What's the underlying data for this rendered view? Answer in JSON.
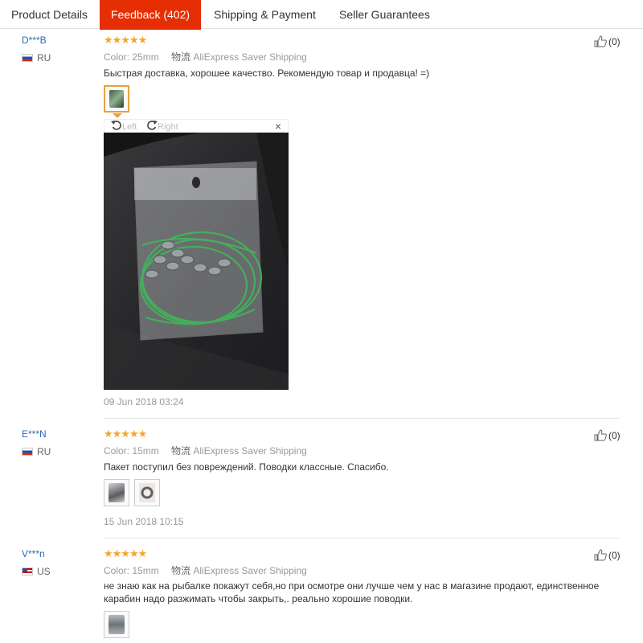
{
  "tabs": [
    {
      "label": "Product Details"
    },
    {
      "label": "Feedback (402)"
    },
    {
      "label": "Shipping & Payment"
    },
    {
      "label": "Seller Guarantees"
    }
  ],
  "colors": {
    "accent": "#e62e04",
    "star": "#f5a623",
    "link": "#2a6ab6"
  },
  "reviews": [
    {
      "user": "D***B",
      "country": "RU",
      "stars": "★★★★★",
      "color_label": "Color:",
      "color_value": "25mm",
      "ship_label": "物流",
      "ship_value": "AliExpress Saver Shipping",
      "text": "Быстрая доставка, хорошее качество. Рекомендую товар и продавца! =)",
      "date": "09 Jun 2018 03:24",
      "helpful": "(0)"
    },
    {
      "user": "E***N",
      "country": "RU",
      "stars": "★★★★★",
      "color_label": "Color:",
      "color_value": "15mm",
      "ship_label": "物流",
      "ship_value": "AliExpress Saver Shipping",
      "text": "Пакет поступил без повреждений. Поводки классные. Спасибо.",
      "date": "15 Jun 2018 10:15",
      "helpful": "(0)"
    },
    {
      "user": "V***n",
      "country": "US",
      "stars": "★★★★★",
      "color_label": "Color:",
      "color_value": "15mm",
      "ship_label": "物流",
      "ship_value": "AliExpress Saver Shipping",
      "text": "не знаю как на рыбалке покажут себя,но при осмотре они лучше чем у нас в магазине продают, единственное карабин надо разжимать чтобы закрыть,. реально хорошие поводки.",
      "helpful": "(0)"
    }
  ],
  "viewer": {
    "left_label": "Left",
    "right_label": "Right",
    "close_label": "×"
  }
}
